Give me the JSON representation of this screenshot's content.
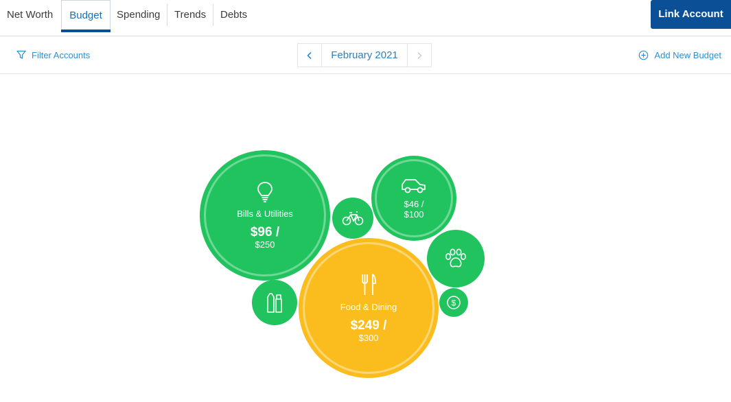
{
  "tabs": [
    {
      "label": "Net Worth"
    },
    {
      "label": "Budget"
    },
    {
      "label": "Spending"
    },
    {
      "label": "Trends"
    },
    {
      "label": "Debts"
    }
  ],
  "link_account_label": "Link Account",
  "toolbar": {
    "filter_label": "Filter Accounts",
    "month_label": "February 2021",
    "prev_icon": "chevron-left-icon",
    "next_icon": "chevron-right-icon",
    "add_budget_label": "Add New Budget"
  },
  "budgets": {
    "bills": {
      "name": "Bills & Utilities",
      "spent": "$96 /",
      "budget": "$250",
      "progress": 0.38,
      "color": "#21c35e",
      "icon": "lightbulb-icon"
    },
    "auto": {
      "spent": "$46 /",
      "budget": "$100",
      "progress": 0.46,
      "color": "#21c35e",
      "icon": "car-icon"
    },
    "food": {
      "name": "Food & Dining",
      "spent": "$249 /",
      "budget": "$300",
      "progress": 0.83,
      "color": "#fbbd1e",
      "icon": "utensils-icon"
    },
    "cycling": {
      "icon": "bicycle-icon",
      "color": "#21c35e"
    },
    "pets": {
      "icon": "paw-icon",
      "color": "#21c35e"
    },
    "personal_care": {
      "icon": "toiletries-icon",
      "color": "#21c35e"
    },
    "other": {
      "icon": "dollar-icon",
      "color": "#21c35e"
    }
  },
  "colors": {
    "accent": "#2e8fcf",
    "primary_button": "#0b4f97",
    "on_budget": "#21c35e",
    "warning": "#fbbd1e"
  }
}
